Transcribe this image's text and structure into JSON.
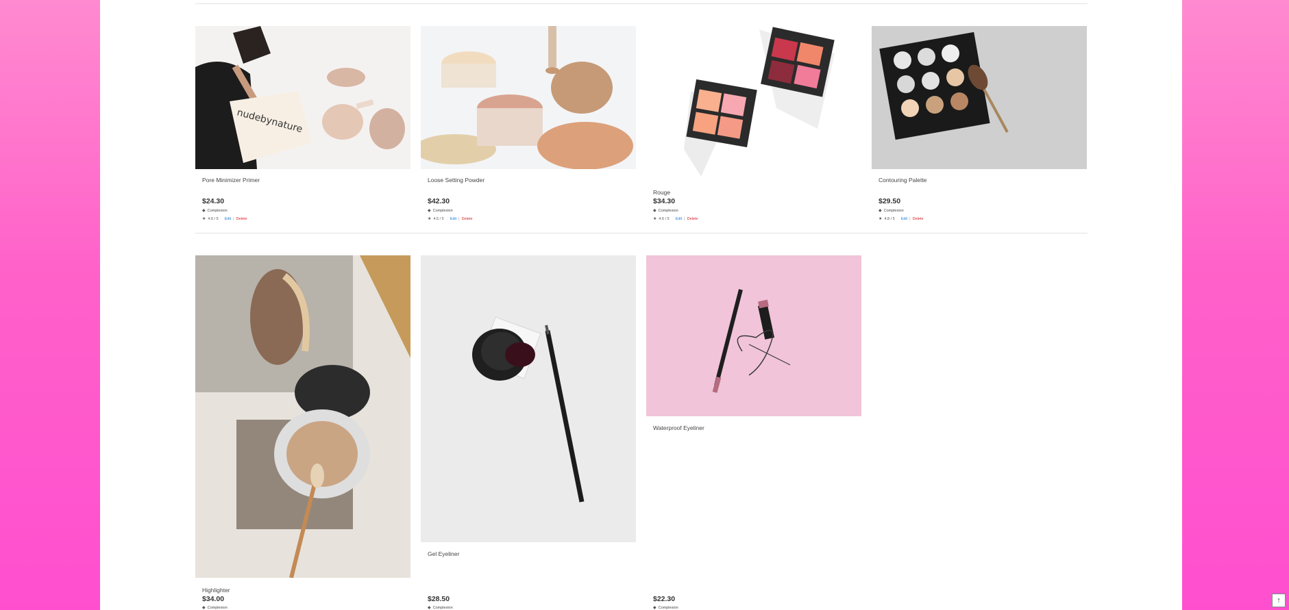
{
  "rows": [
    {
      "products": [
        {
          "name": "Pore Minimizer Primer",
          "price": "$24.30",
          "category": "Complexion",
          "rating": "4.6 / 5",
          "edit_label": "Edit",
          "sep": "|",
          "delete_label": "Delete",
          "image": "primer-brush-photo"
        },
        {
          "name": "Loose Setting Powder",
          "price": "$42.30",
          "category": "Complexion",
          "rating": "4.5 / 5",
          "edit_label": "Edit",
          "sep": "|",
          "delete_label": "Delete",
          "image": "setting-powder-photo"
        },
        {
          "name": "Rouge",
          "price": "$34.30",
          "category": "Complexion",
          "rating": "4.6 / 5",
          "edit_label": "Edit",
          "sep": "|",
          "delete_label": "Delete",
          "image": "blush-palette-photo"
        },
        {
          "name": "Contouring Palette",
          "price": "$29.50",
          "category": "Complexion",
          "rating": "4.8 / 5",
          "edit_label": "Edit",
          "sep": "|",
          "delete_label": "Delete",
          "image": "contour-palette-photo"
        }
      ]
    },
    {
      "products": [
        {
          "name": "Highlighter",
          "price": "$34.00",
          "category": "Complexion",
          "image": "highlighter-compact-photo"
        },
        {
          "name": "Gel Eyeliner",
          "price": "$28.50",
          "category": "Complexion",
          "image": "gel-eyeliner-photo"
        },
        {
          "name": "Waterproof Eyeliner",
          "price": "$22.30",
          "category": "Complexion",
          "image": "liquid-eyeliner-photo"
        }
      ]
    }
  ],
  "scroll_top_icon": "arrow-up-icon",
  "scroll_top_glyph": "↑",
  "colors": {
    "background_pink": "#ff61c9",
    "edit_link": "#1e7bd6",
    "delete_link": "#d9222a"
  }
}
